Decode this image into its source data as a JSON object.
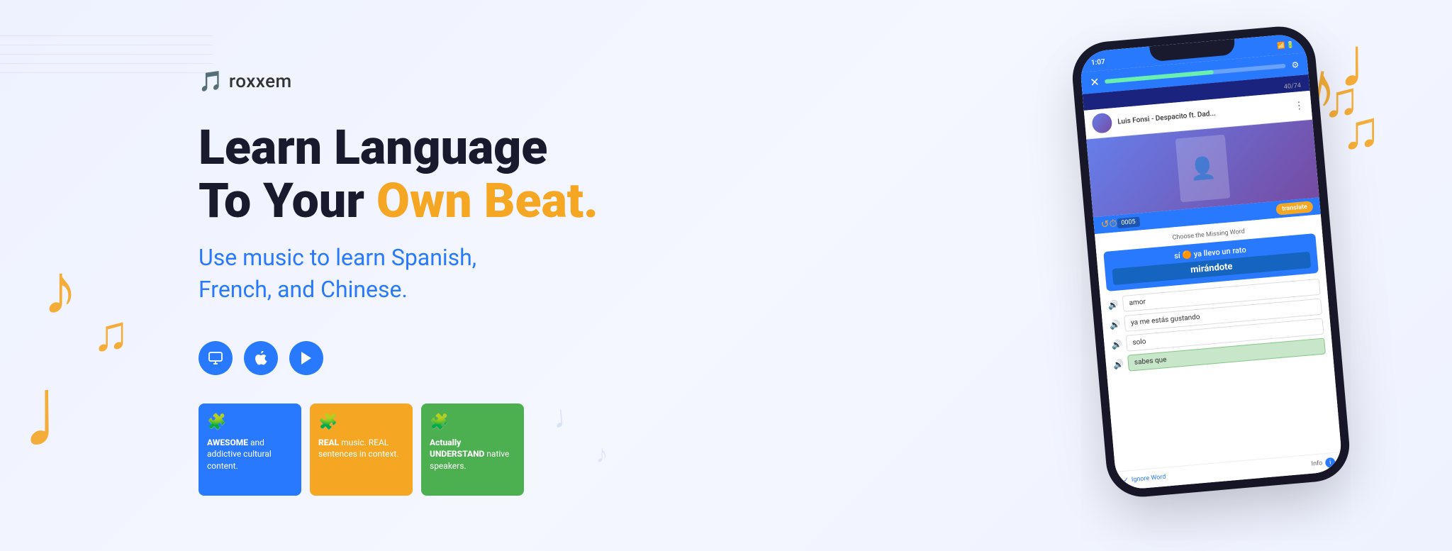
{
  "logo": {
    "text": "roxxem",
    "icon": "🎵"
  },
  "headline": {
    "line1": "Learn Language",
    "line2_start": "To Your ",
    "line2_highlight": "Own Beat."
  },
  "subtitle": {
    "line1": "Use music to learn Spanish,",
    "line2": "French, and Chinese."
  },
  "platforms": [
    {
      "name": "desktop",
      "icon": "🖥"
    },
    {
      "name": "apple",
      "icon": ""
    },
    {
      "name": "play",
      "icon": "▶"
    }
  ],
  "feature_cards": [
    {
      "id": "card-awesome",
      "color": "blue",
      "icon": "🧩",
      "text_bold": "AWESOME",
      "text_rest": " and addictive cultural content."
    },
    {
      "id": "card-real",
      "color": "orange",
      "icon": "🧩",
      "text_bold": "REAL",
      "text_rest": " music. REAL sentences in context."
    },
    {
      "id": "card-understand",
      "color": "green",
      "icon": "🧩",
      "text_bold": "Actually UNDERSTAND",
      "text_rest": " native speakers."
    }
  ],
  "phone": {
    "status_time": "1:07",
    "status_icons": "▲▲ LTE■",
    "progress_label": "40/74",
    "song_title": "Luis Fonsi - Despacito ft. Dad...",
    "quiz_prompt": "Choose the Missing Word",
    "lyrics_line": "sí 🟠 ya llevo un rato",
    "lyrics_answer": "mirándote",
    "time_display": "0005",
    "translate_label": "translate",
    "answers": [
      {
        "text": "amor",
        "correct": false
      },
      {
        "text": "ya me estás gustando",
        "correct": false
      },
      {
        "text": "solo",
        "correct": false
      },
      {
        "text": "sabes que",
        "correct": true
      }
    ],
    "ignore_word": "Ignore Word",
    "info_label": "Info"
  }
}
